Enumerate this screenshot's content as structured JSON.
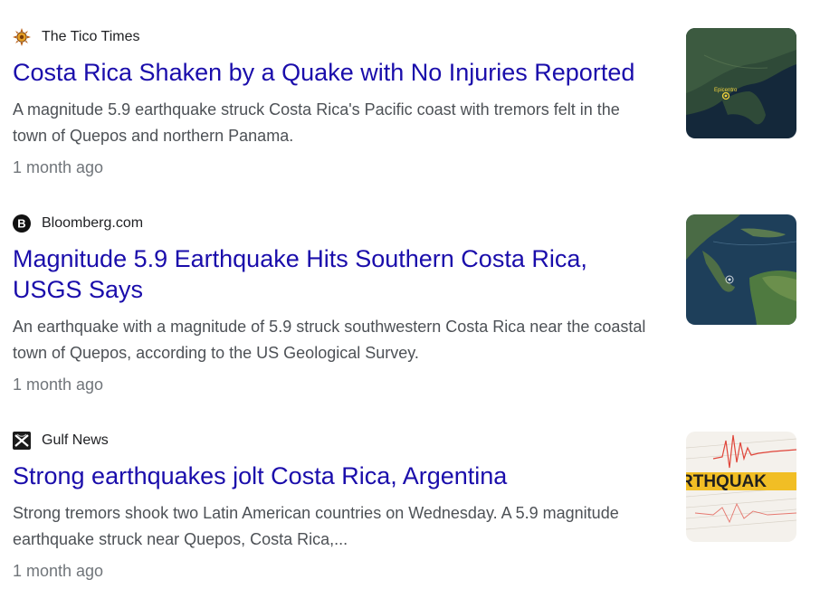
{
  "results": [
    {
      "source": "The Tico Times",
      "favicon": "sun-icon",
      "title": "Costa Rica Shaken by a Quake with No Injuries Reported",
      "snippet": "A magnitude 5.9 earthquake struck Costa Rica's Pacific coast with tremors felt in the town of Quepos and northern Panama.",
      "age": "1 month ago",
      "thumbnail": {
        "kind": "map",
        "label": "Epicentro"
      }
    },
    {
      "source": "Bloomberg.com",
      "favicon": "bloomberg-b-icon",
      "title": "Magnitude 5.9 Earthquake Hits Southern Costa Rica, USGS Says",
      "snippet": "An earthquake with a magnitude of 5.9 struck southwestern Costa Rica near the coastal town of Quepos, according to the US Geological Survey.",
      "age": "1 month ago",
      "thumbnail": {
        "kind": "satellite-map"
      }
    },
    {
      "source": "Gulf News",
      "favicon": "gulf-news-logo-icon",
      "title": "Strong earthquakes jolt Costa Rica, Argentina",
      "snippet": "Strong tremors shook two Latin American countries on Wednesday. A 5.9 magnitude earthquake struck near Quepos, Costa Rica,...",
      "age": "1 month ago",
      "thumbnail": {
        "kind": "seismograph",
        "label": "RTHQUAK"
      }
    }
  ],
  "colors": {
    "link": "#1a0dab",
    "snippet": "#4d5156",
    "meta": "#70757a"
  }
}
